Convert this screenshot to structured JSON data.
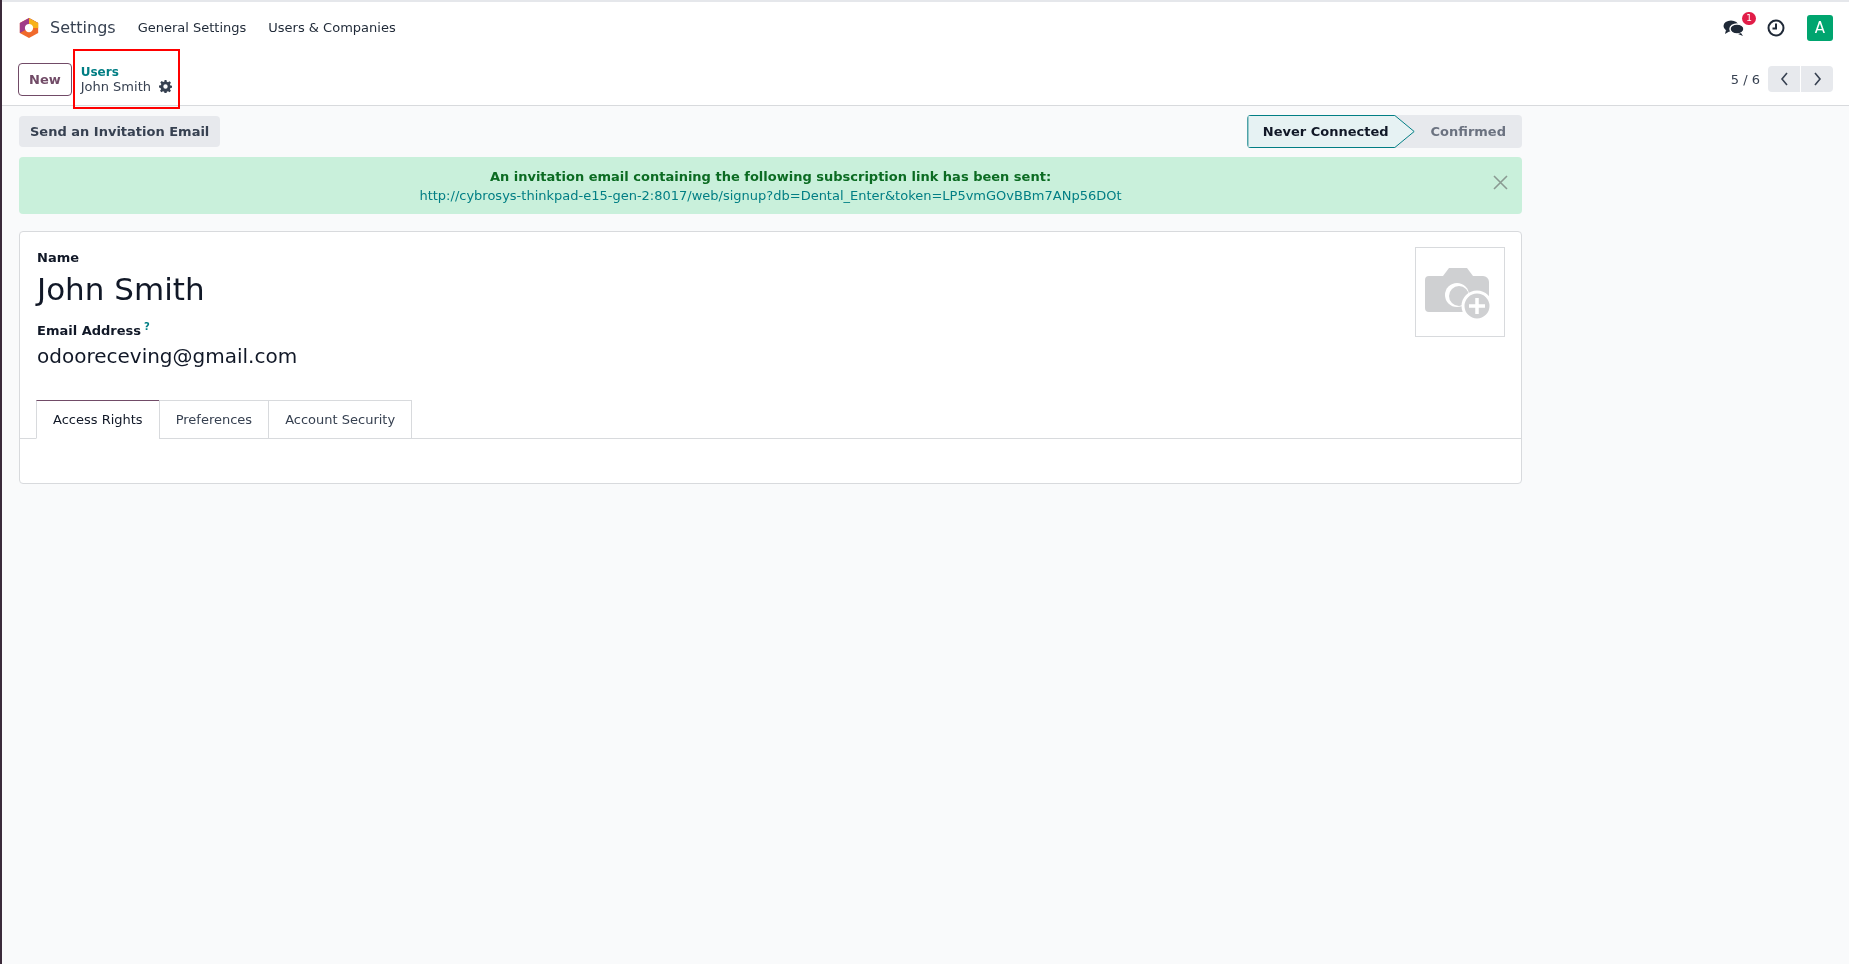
{
  "app": {
    "name": "Settings"
  },
  "menu": [
    {
      "label": "General Settings"
    },
    {
      "label": "Users & Companies"
    }
  ],
  "systray": {
    "message_count": "1",
    "avatar": "A"
  },
  "control_panel": {
    "new_button": "New",
    "breadcrumb": {
      "parent": "Users",
      "current": "John Smith",
      "highlighted": true
    },
    "pager": "5 / 6"
  },
  "action_buttons": [
    "Send an Invitation Email"
  ],
  "status_stages": [
    {
      "label": "Never Connected",
      "selected": true
    },
    {
      "label": "Confirmed",
      "selected": false
    }
  ],
  "alert": {
    "message": "An invitation email containing the following subscription link has been sent:",
    "link": "http://cybrosys-thinkpad-e15-gen-2:8017/web/signup?db=Dental_Enter&token=LP5vmGOvBBm7ANp56DOt"
  },
  "form": {
    "name_label": "Name",
    "name": "John Smith",
    "email_label": "Email Address",
    "email_help": "?",
    "email": "odooreceving@gmail.com"
  },
  "tabs": [
    {
      "label": "Access Rights",
      "selected": true
    },
    {
      "label": "Preferences",
      "selected": false
    },
    {
      "label": "Account Security",
      "selected": false
    }
  ]
}
